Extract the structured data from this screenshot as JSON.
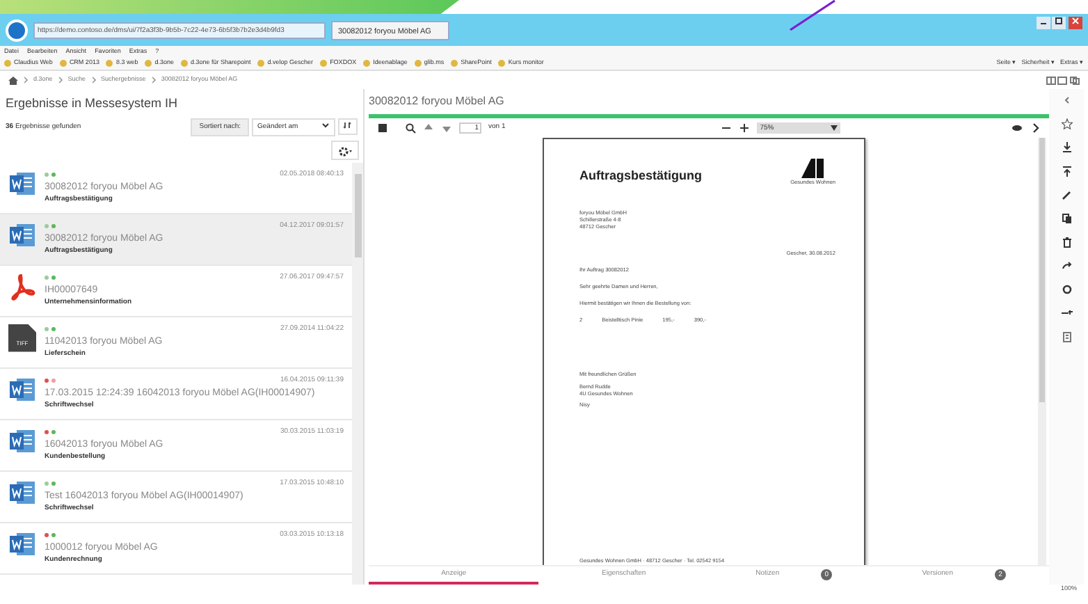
{
  "browser": {
    "address": "https://demo.contoso.de/dms/ui/7f2a3f3b-9b5b-7c22-4e73-6b5f3b7b2e3d4b9fd3",
    "tab": "30082012 foryou Möbel AG",
    "menu": [
      "Datei",
      "Bearbeiten",
      "Ansicht",
      "Favoriten",
      "Extras",
      "?"
    ],
    "favorites": [
      "Claudius Web",
      "CRM 2013",
      "8.3 web",
      "d.3one",
      "d.3one für Sharepoint",
      "d.velop Gescher",
      "FOXDOX",
      "Ideenablage",
      "glib.ms",
      "SharePoint",
      "Kurs monitor"
    ],
    "commands": [
      "Seite ▾",
      "Sicherheit ▾",
      "Extras ▾"
    ]
  },
  "breadcrumb": [
    "d.3one",
    "Suche",
    "Suchergebnisse",
    "30082012 foryou Möbel AG"
  ],
  "results": {
    "title": "Ergebnisse in Messesystem IH",
    "count": "36",
    "count_label": "Ergebnisse gefunden",
    "sort_label": "Sortiert nach:",
    "sort_value": "Geändert am",
    "items": [
      {
        "kind": "word",
        "date": "02.05.2018 08:40:13",
        "title": "30082012 foryou Möbel AG",
        "type": "Auftragsbestätigung",
        "selected": false,
        "markers": [
          {
            "color": "#9acd9a"
          },
          {
            "color": "#5cb85c"
          }
        ]
      },
      {
        "kind": "word",
        "date": "04.12.2017 09:01:57",
        "title": "30082012 foryou Möbel AG",
        "type": "Auftragsbestätigung",
        "selected": true,
        "markers": [
          {
            "color": "#9acd9a"
          },
          {
            "color": "#5cb85c"
          }
        ]
      },
      {
        "kind": "pdf",
        "date": "27.06.2017 09:47:57",
        "title": "IH00007649",
        "type": "Unternehmensinformation",
        "selected": false,
        "markers": [
          {
            "color": "#9acd9a"
          },
          {
            "color": "#5cb85c"
          }
        ]
      },
      {
        "kind": "tiff",
        "file_label": "TIFF",
        "date": "27.09.2014 11:04:22",
        "title": "11042013 foryou Möbel AG",
        "type": "Lieferschein",
        "selected": false,
        "markers": [
          {
            "color": "#9acd9a"
          },
          {
            "color": "#5cb85c"
          }
        ]
      },
      {
        "kind": "word",
        "date": "16.04.2015 09:11:39",
        "title": "17.03.2015 12:24:39 16042013 foryou Möbel AG(IH00014907)",
        "type": "Schriftwechsel",
        "selected": false,
        "markers": [
          {
            "color": "#e05050"
          },
          {
            "color": "#f0a0a0"
          }
        ]
      },
      {
        "kind": "word",
        "date": "30.03.2015 11:03:19",
        "title": "16042013 foryou Möbel AG",
        "type": "Kundenbestellung",
        "selected": false,
        "markers": [
          {
            "color": "#e05050"
          },
          {
            "color": "#5cb85c"
          }
        ]
      },
      {
        "kind": "word",
        "date": "17.03.2015 10:48:10",
        "title": "Test 16042013 foryou Möbel AG(IH00014907)",
        "type": "Schriftwechsel",
        "selected": false,
        "markers": [
          {
            "color": "#9acd9a"
          },
          {
            "color": "#5cb85c"
          }
        ]
      },
      {
        "kind": "word",
        "date": "03.03.2015 10:13:18",
        "title": "1000012 foryou Möbel AG",
        "type": "Kundenrechnung",
        "selected": false,
        "markers": [
          {
            "color": "#e05050"
          },
          {
            "color": "#5cb85c"
          }
        ]
      }
    ]
  },
  "viewer": {
    "title": "30082012 foryou Möbel AG",
    "page": "1",
    "page_of": "von 1",
    "zoom": "75%",
    "document": {
      "heading": "Auftragsbestätigung",
      "logo_text": "Gesundes Wohnen",
      "lines": [
        {
          "kind": "address",
          "text": "foryou Möbel GmbH"
        },
        {
          "kind": "address",
          "text": "Schillerstraße 4-8"
        },
        {
          "kind": "address",
          "text": "48712 Gescher"
        },
        {
          "kind": "date",
          "text": "Gescher, 30.08.2012"
        },
        {
          "kind": "text",
          "text": "Ihr Auftrag 30082012"
        },
        {
          "kind": "text",
          "text": "Sehr geehrte Damen und Herren,"
        },
        {
          "kind": "text",
          "text": "Hiermit bestätigen wir Ihnen die Bestellung von:"
        },
        {
          "kind": "position",
          "cells": [
            "2",
            "Beistelltisch Pinie",
            "195,-",
            "390,-"
          ]
        },
        {
          "kind": "gap"
        },
        {
          "kind": "text",
          "text": "Mit freundlichen Grüßen"
        },
        {
          "kind": "address",
          "text": "Bernd Rudde"
        },
        {
          "kind": "address",
          "text": "4U Gesundes Wohnen"
        },
        {
          "kind": "text",
          "text": "Nisy"
        },
        {
          "kind": "footer",
          "text": "Gesundes Wohnen GmbH · 48712 Gescher · Tel. 02542 9154"
        }
      ]
    },
    "tabs": [
      {
        "label": "Anzeige",
        "selected": true
      },
      {
        "label": "Eigenschaften",
        "selected": false
      },
      {
        "label": "Notizen",
        "selected": false,
        "count": "0"
      },
      {
        "label": "Versionen",
        "selected": false,
        "count": "2"
      }
    ]
  },
  "status": {
    "zoom": "100%"
  }
}
